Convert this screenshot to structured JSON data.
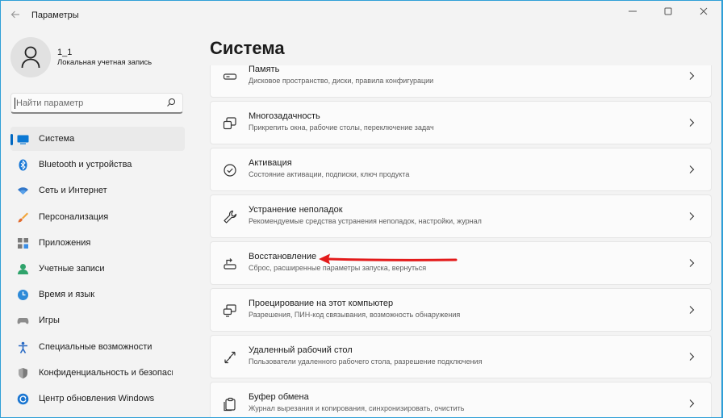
{
  "window": {
    "title": "Параметры",
    "back_icon": "back-arrow-icon",
    "controls": [
      "minimize-icon",
      "maximize-icon",
      "close-icon"
    ]
  },
  "profile": {
    "name": "1_1",
    "account_type": "Локальная учетная запись"
  },
  "search": {
    "placeholder": "Найти параметр",
    "value": ""
  },
  "sidebar": {
    "items": [
      {
        "label": "Система",
        "icon": "system-icon",
        "active": true
      },
      {
        "label": "Bluetooth и устройства",
        "icon": "bluetooth-icon"
      },
      {
        "label": "Сеть и Интернет",
        "icon": "wifi-icon"
      },
      {
        "label": "Персонализация",
        "icon": "brush-icon"
      },
      {
        "label": "Приложения",
        "icon": "apps-icon"
      },
      {
        "label": "Учетные записи",
        "icon": "accounts-icon"
      },
      {
        "label": "Время и язык",
        "icon": "globe-clock-icon"
      },
      {
        "label": "Игры",
        "icon": "gamepad-icon"
      },
      {
        "label": "Специальные возможности",
        "icon": "accessibility-icon"
      },
      {
        "label": "Конфиденциальность и безопасность",
        "icon": "shield-icon"
      },
      {
        "label": "Центр обновления Windows",
        "icon": "update-icon"
      }
    ]
  },
  "main": {
    "title": "Система",
    "cards": [
      {
        "title": "Память",
        "desc": "Дисковое пространство, диски, правила конфигурации",
        "icon": "storage-icon"
      },
      {
        "title": "Многозадачность",
        "desc": "Прикрепить окна, рабочие столы, переключение задач",
        "icon": "multitasking-icon"
      },
      {
        "title": "Активация",
        "desc": "Состояние активации, подписки, ключ продукта",
        "icon": "activation-icon"
      },
      {
        "title": "Устранение неполадок",
        "desc": "Рекомендуемые средства устранения неполадок, настройки, журнал",
        "icon": "wrench-icon"
      },
      {
        "title": "Восстановление",
        "desc": "Сброс, расширенные параметры запуска, вернуться",
        "icon": "recovery-icon"
      },
      {
        "title": "Проецирование на этот компьютер",
        "desc": "Разрешения, ПИН-код связывания, возможность обнаружения",
        "icon": "projection-icon"
      },
      {
        "title": "Удаленный рабочий стол",
        "desc": "Пользователи удаленного рабочего стола, разрешение подключения",
        "icon": "remote-desktop-icon"
      },
      {
        "title": "Буфер обмена",
        "desc": "Журнал вырезания и копирования, синхронизировать, очистить",
        "icon": "clipboard-icon"
      }
    ]
  },
  "colors": {
    "accent": "#0067c0",
    "annotation_arrow": "#e31b1b",
    "background": "#f3f3f3",
    "card": "#fbfbfb"
  }
}
